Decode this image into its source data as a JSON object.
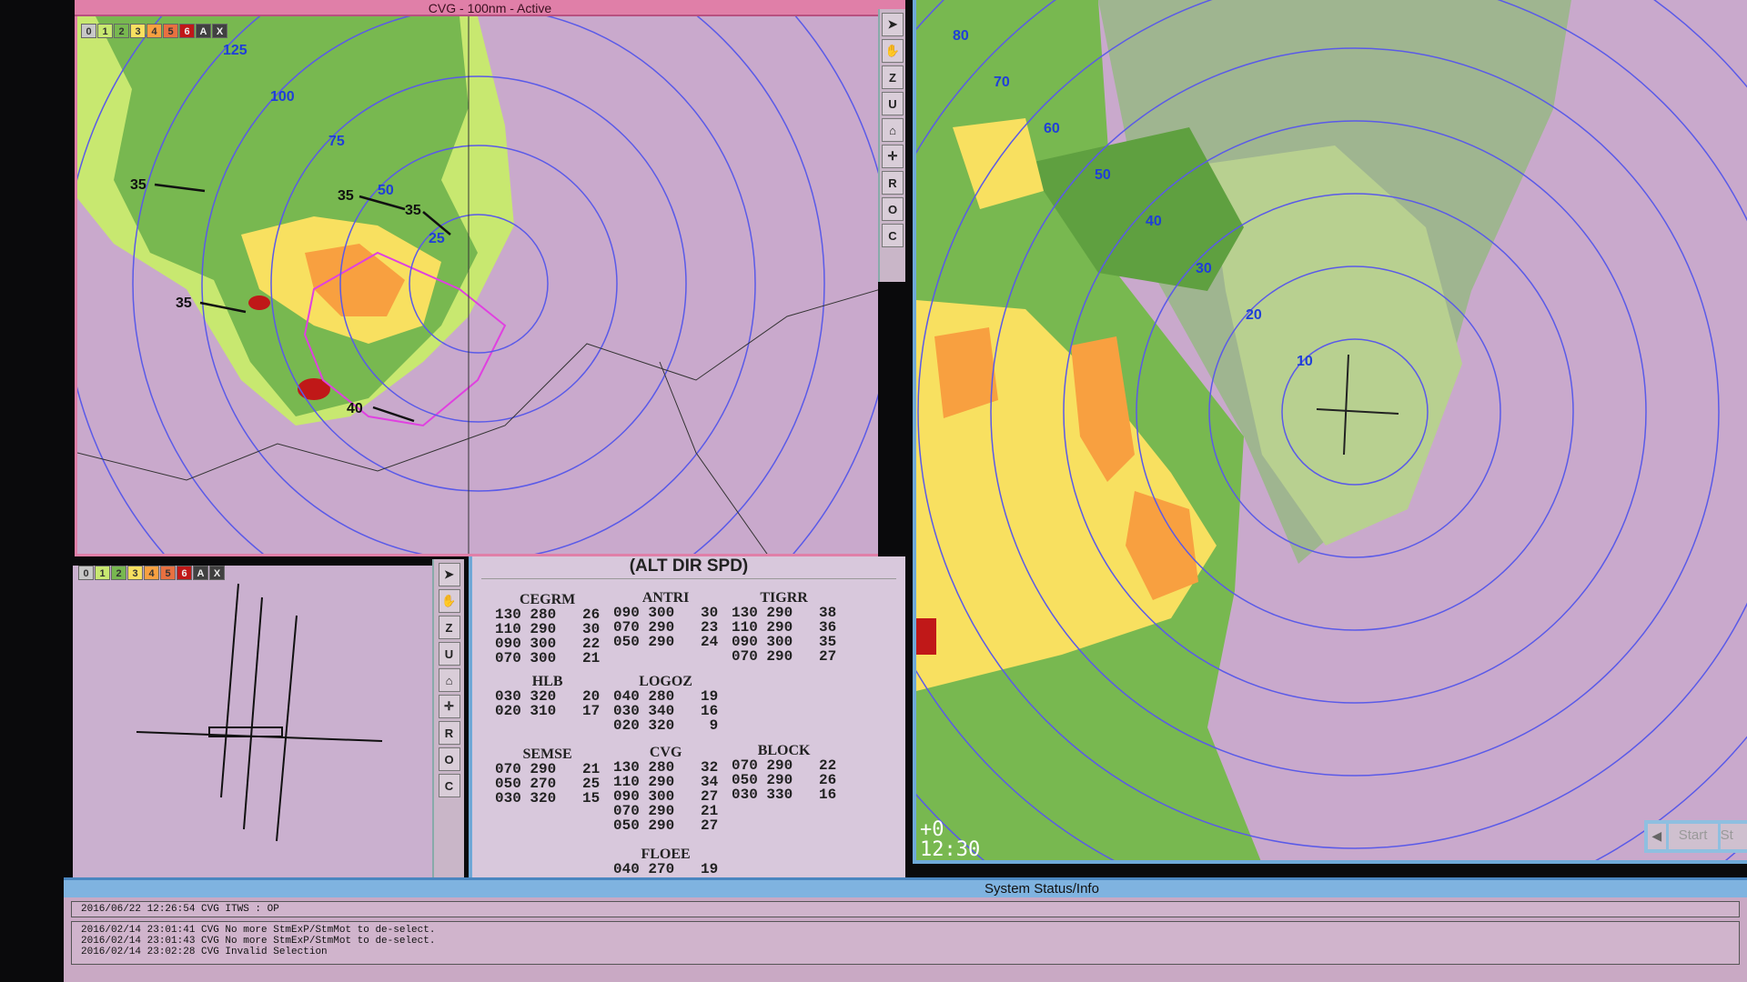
{
  "main_window": {
    "title": "CVG - 100nm - Active",
    "legend": [
      "0",
      "1",
      "2",
      "3",
      "4",
      "5",
      "6",
      "A",
      "X"
    ],
    "ring_labels": [
      "125",
      "100",
      "75",
      "50",
      "25"
    ],
    "storm_labels": [
      "35",
      "35",
      "35",
      "35",
      "40"
    ]
  },
  "toolbar": {
    "buttons": [
      {
        "icon": "pointer-icon",
        "label": ""
      },
      {
        "icon": "hand-icon",
        "label": ""
      },
      {
        "icon": "",
        "label": "Z"
      },
      {
        "icon": "",
        "label": "U"
      },
      {
        "icon": "home-icon",
        "label": ""
      },
      {
        "icon": "crosshair-icon",
        "label": ""
      },
      {
        "icon": "",
        "label": "R"
      },
      {
        "icon": "",
        "label": "O"
      },
      {
        "icon": "",
        "label": "C"
      }
    ]
  },
  "legend_colors": [
    "#c8c8c8",
    "#c8e870",
    "#78b850",
    "#f8e060",
    "#f8a040",
    "#e87040",
    "#c01818",
    "#404040",
    "#404040"
  ],
  "small_window": {
    "legend": [
      "0",
      "1",
      "2",
      "3",
      "4",
      "5",
      "6",
      "A",
      "X"
    ]
  },
  "wind_table": {
    "title": "(ALT DIR SPD)",
    "groups": [
      {
        "name": "CEGRM",
        "rows": [
          "130 280   26",
          "110 290   30",
          "090 300   22",
          "070 300   21"
        ]
      },
      {
        "name": "ANTRI",
        "rows": [
          "090 300   30",
          "070 290   23",
          "050 290   24"
        ]
      },
      {
        "name": "TIGRR",
        "rows": [
          "130 290   38",
          "110 290   36",
          "090 300   35",
          "070 290   27"
        ]
      },
      {
        "name": "HLB",
        "rows": [
          "030 320   20",
          "020 310   17"
        ]
      },
      {
        "name": "LOGOZ",
        "rows": [
          "040 280   19",
          "030 340   16",
          "020 320    9"
        ]
      },
      {
        "name": "SEMSE",
        "rows": [
          "070 290   21",
          "050 270   25",
          "030 320   15"
        ]
      },
      {
        "name": "CVG",
        "rows": [
          "130 280   32",
          "110 290   34",
          "090 300   27",
          "070 290   21",
          "050 290   27"
        ]
      },
      {
        "name": "BLOCK",
        "rows": [
          "070 290   22",
          "050 290   26",
          "030 330   16"
        ]
      },
      {
        "name": "FLOEE",
        "rows": [
          "040 270   19"
        ]
      }
    ]
  },
  "right_map": {
    "ring_labels": [
      "80",
      "70",
      "60",
      "50",
      "40",
      "30",
      "20",
      "10"
    ],
    "offset": "+0",
    "time": "12:30",
    "controls": [
      "Start",
      "St"
    ]
  },
  "status": {
    "title": "System Status/Info",
    "current": "2016/06/22 12:26:54 CVG ITWS : OP",
    "log": [
      "2016/02/14 23:01:41 CVG No more StmExP/StmMot to de-select.",
      "2016/02/14 23:01:43 CVG No more StmExP/StmMot to de-select.",
      "2016/02/14 23:02:28 CVG Invalid Selection"
    ]
  }
}
